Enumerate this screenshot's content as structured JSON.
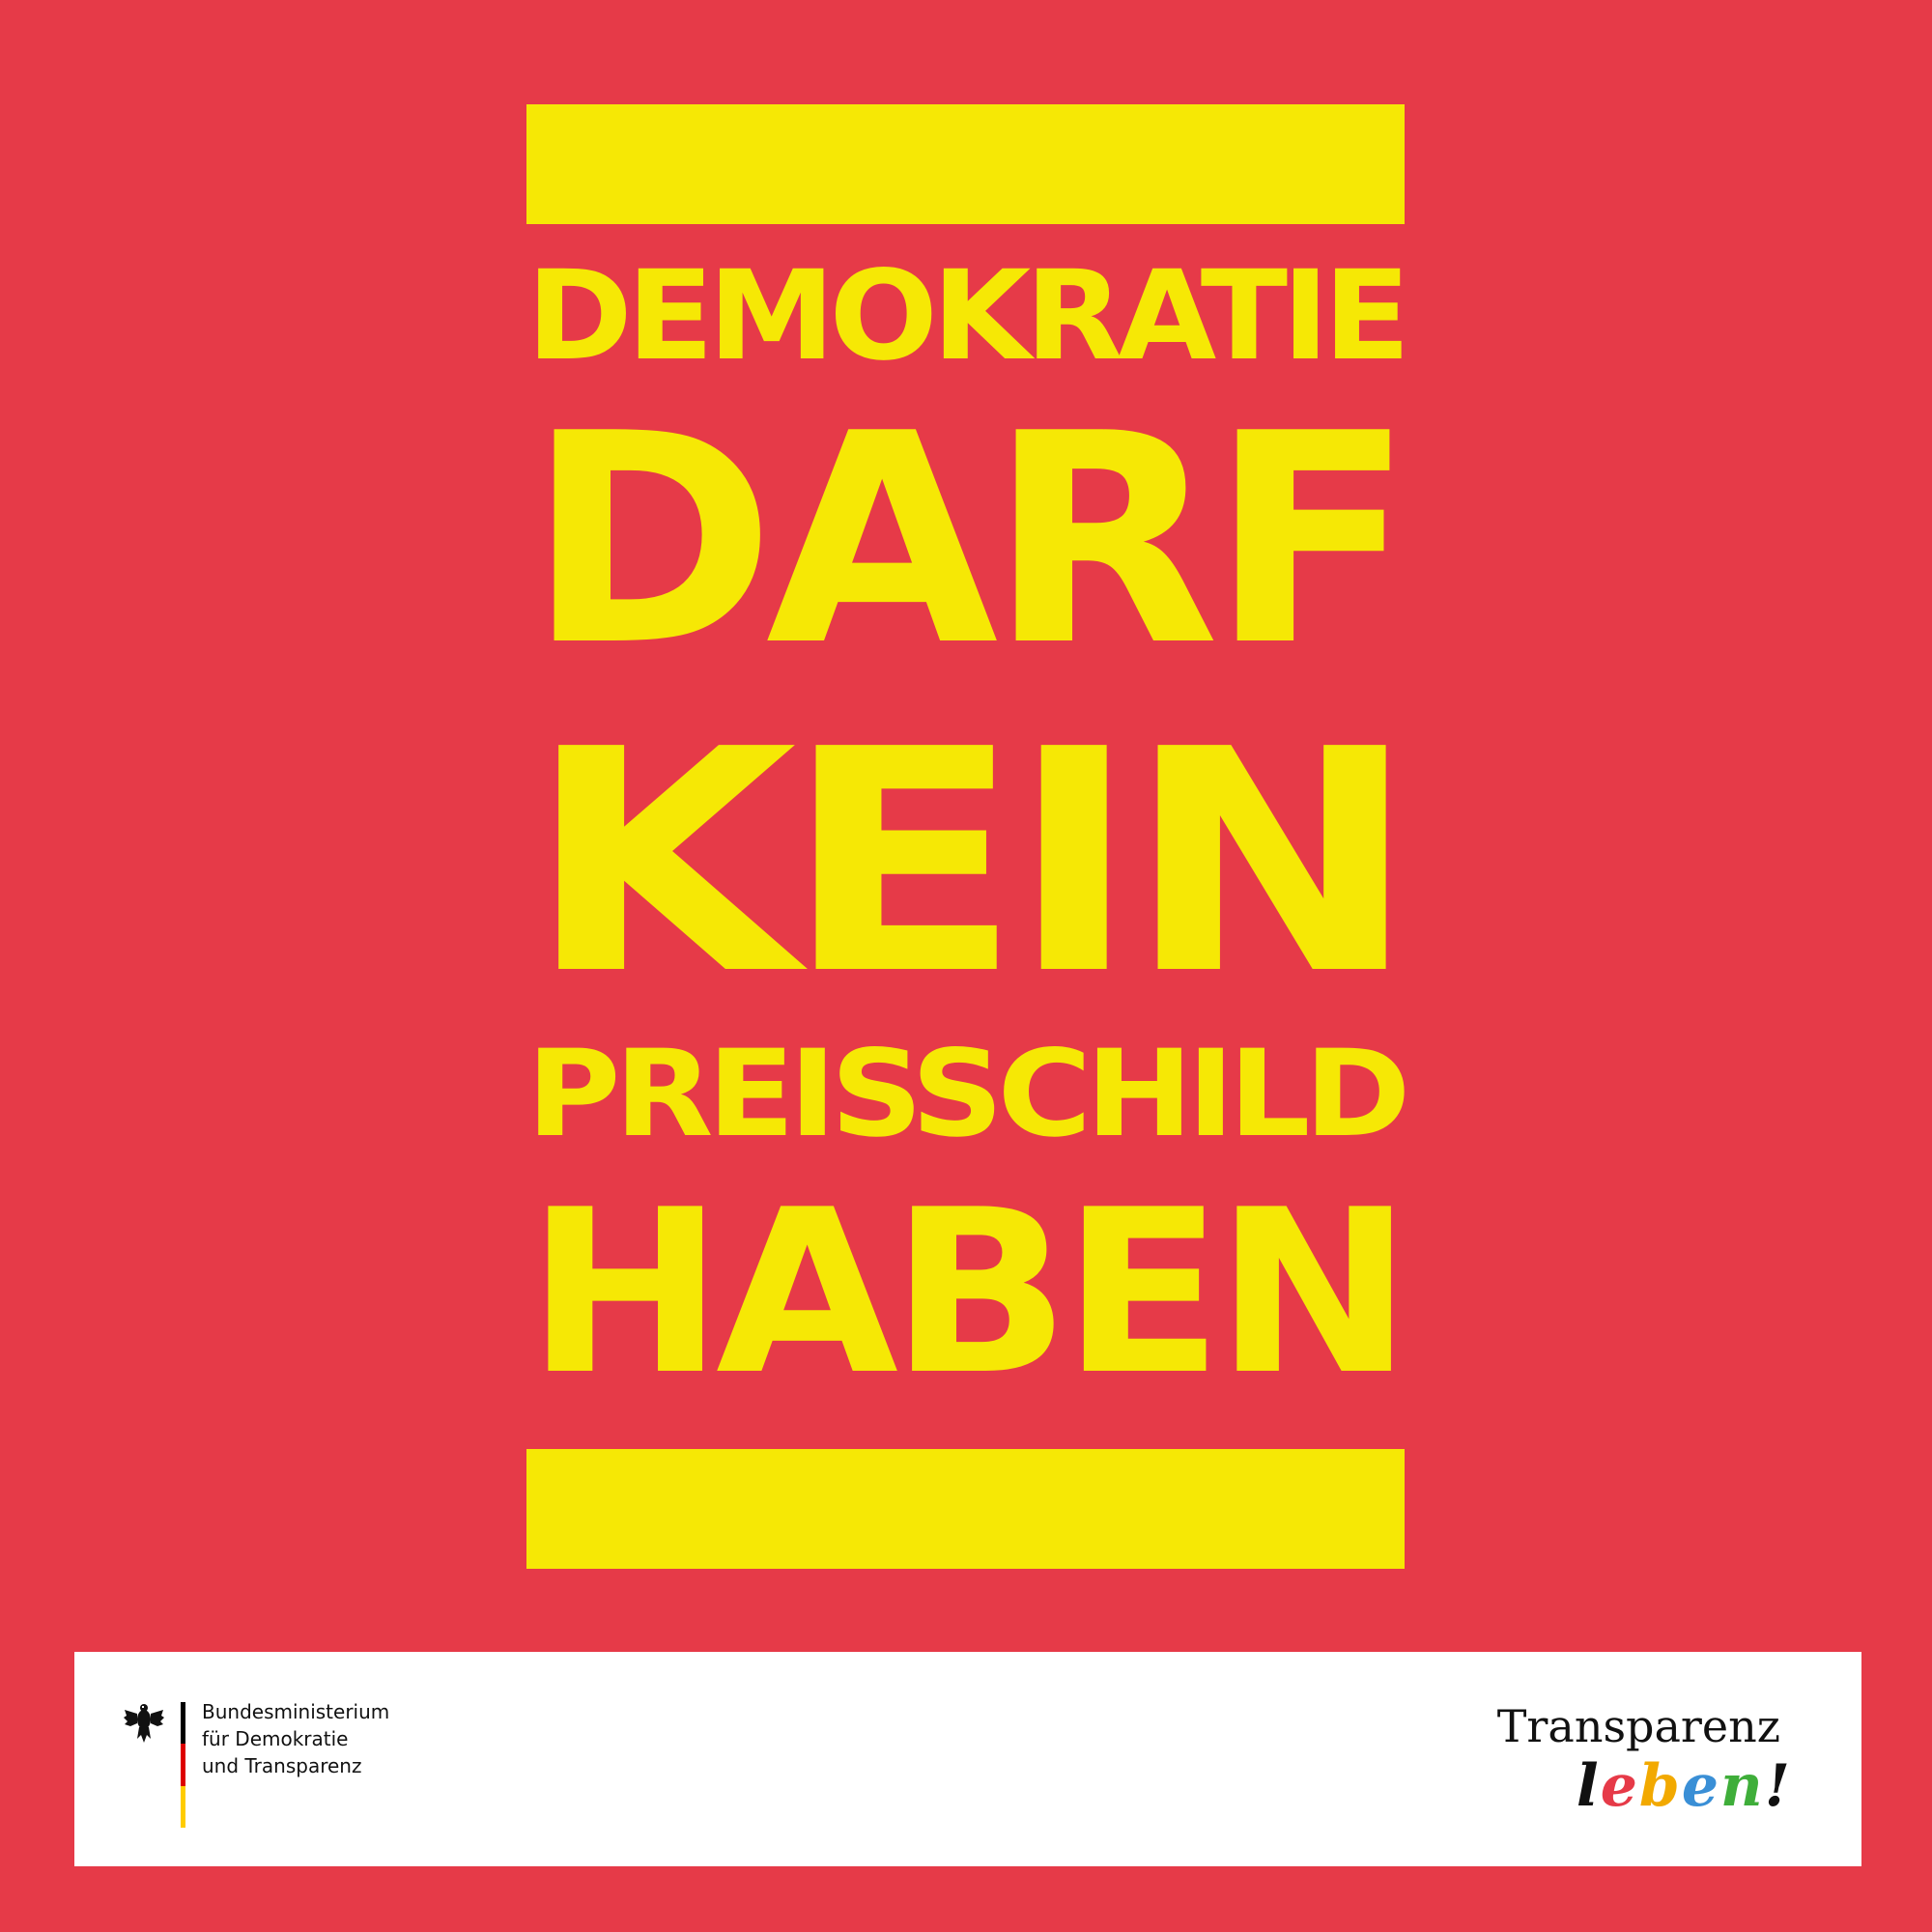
{
  "poster": {
    "background_color": "#e63a48",
    "text_color": "#f6e805",
    "lines": [
      "Demokratie",
      "darf",
      "kein",
      "Preisschild",
      "haben"
    ]
  },
  "footer": {
    "ministry_lines": [
      "Bundesministerium",
      "für Demokratie",
      "und Transparenz"
    ],
    "eagle_icon": "federal-eagle-icon",
    "flag_colors": [
      "#000000",
      "#dd0000",
      "#ffcc00"
    ],
    "logo": {
      "word": "Transparenz",
      "script_letters": [
        "l",
        "e",
        "b",
        "e",
        "n",
        "!"
      ],
      "script_colors": [
        "#111111",
        "#e63a48",
        "#f2a900",
        "#3a8fd6",
        "#3fae3a",
        "#111111"
      ]
    }
  }
}
